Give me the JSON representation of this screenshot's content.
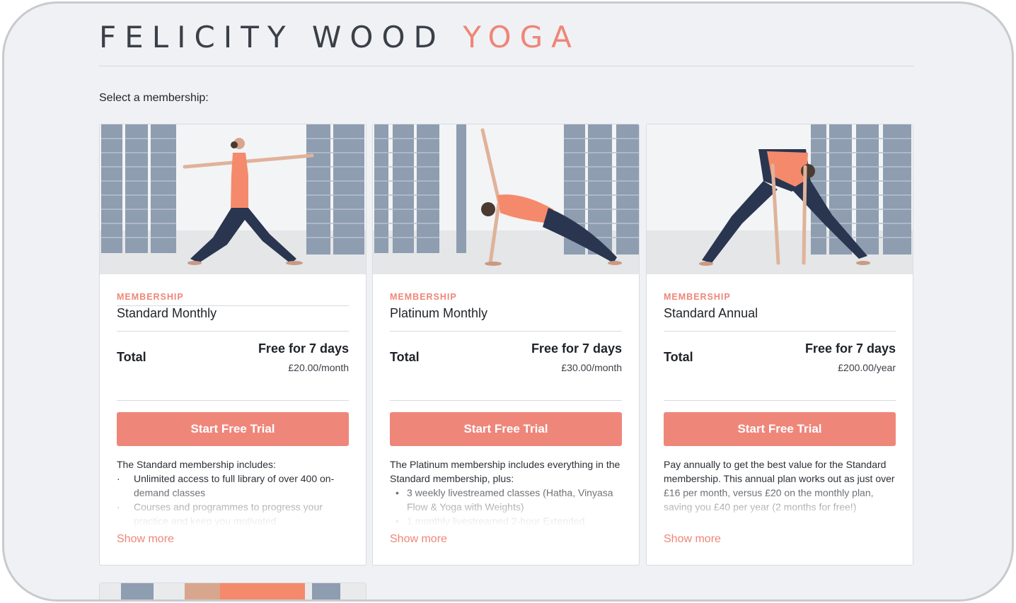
{
  "brand": {
    "name_part1": "FELICITY WOOD",
    "name_part2": "YOGA"
  },
  "prompt": "Select a membership:",
  "memberships": [
    {
      "tag": "MEMBERSHIP",
      "name": "Standard Monthly",
      "total_label": "Total",
      "trial": "Free for 7 days",
      "price": "£20.00/month",
      "cta": "Start Free Trial",
      "intro": "The Standard membership includes:",
      "bullets": [
        "Unlimited access to full library of over 400 on-demand classes",
        "Courses and programmes to progress your practice and keep you motivated"
      ],
      "show_more": "Show more"
    },
    {
      "tag": "MEMBERSHIP",
      "name": "Platinum Monthly",
      "total_label": "Total",
      "trial": "Free for 7 days",
      "price": "£30.00/month",
      "cta": "Start Free Trial",
      "intro": "The Platinum membership includes everything in the Standard membership, plus:",
      "bullets": [
        "3 weekly livestreamed classes (Hatha, Vinyasa Flow & Yoga with Weights)",
        "1 monthly livestreamed 2-hour Extended"
      ],
      "show_more": "Show more"
    },
    {
      "tag": "MEMBERSHIP",
      "name": "Standard Annual",
      "total_label": "Total",
      "trial": "Free for 7 days",
      "price": "£200.00/year",
      "cta": "Start Free Trial",
      "intro": "Pay annually to get the best value for the Standard membership. This annual plan works out as just over £16 per month, versus £20 on the monthly plan, saving you £40 per year (2 months for free!)",
      "show_more": "Show more"
    }
  ],
  "colors": {
    "accent": "#ef8677",
    "button": "#ef867a",
    "text": "#1f2328",
    "background": "#f0f1f5"
  },
  "icons": {
    "bullet_1": "middle-dot",
    "bullet_2": "disc-bullet"
  }
}
